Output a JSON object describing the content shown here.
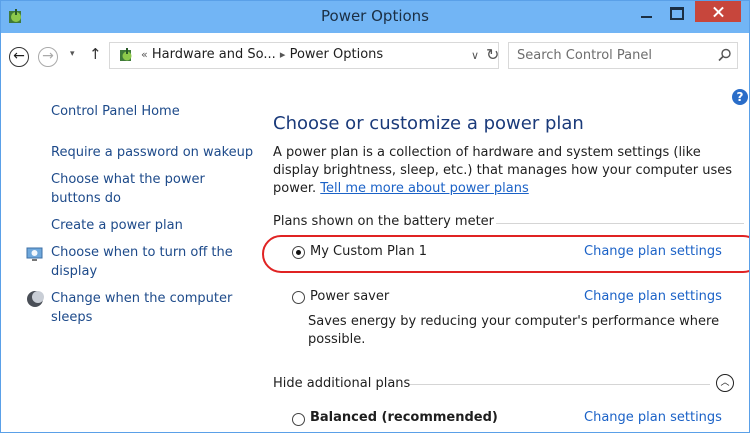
{
  "window": {
    "title": "Power Options",
    "accent_color": "#72b5f5",
    "close_color": "#c7463c"
  },
  "nav": {
    "back_icon": "back-arrow-icon",
    "forward_icon": "forward-arrow-icon",
    "up_icon": "up-arrow-icon",
    "breadcrumb_prefix": "«",
    "breadcrumb_1": "Hardware and So...",
    "breadcrumb_sep": "▸",
    "breadcrumb_2": "Power Options",
    "search_placeholder": "Search Control Panel"
  },
  "sidebar": {
    "home": "Control Panel Home",
    "items": [
      {
        "label_1": "Require a password on wakeup"
      },
      {
        "label_1": "Choose what the power",
        "label_2": "buttons do"
      },
      {
        "label_1": "Create a power plan"
      },
      {
        "label_1": "Choose when to turn off the",
        "label_2": "display",
        "icon": "display-icon"
      },
      {
        "label_1": "Change when the computer",
        "label_2": "sleeps",
        "icon": "sleep-moon-icon"
      }
    ]
  },
  "main": {
    "heading": "Choose or customize a power plan",
    "description": "A power plan is a collection of hardware and system settings (like display brightness, sleep, etc.) that manages how your computer uses power.",
    "learn_more_link": "Tell me more about power plans",
    "section_battery": "Plans shown on the battery meter",
    "section_hidden": "Hide additional plans",
    "change_label": "Change plan settings",
    "plans": [
      {
        "name": "My Custom Plan 1",
        "selected": true
      },
      {
        "name": "Power saver",
        "selected": false,
        "description": "Saves energy by reducing your computer's performance where possible."
      },
      {
        "name": "Balanced (recommended)",
        "selected": false
      }
    ],
    "highlight_color": "#e02323"
  }
}
